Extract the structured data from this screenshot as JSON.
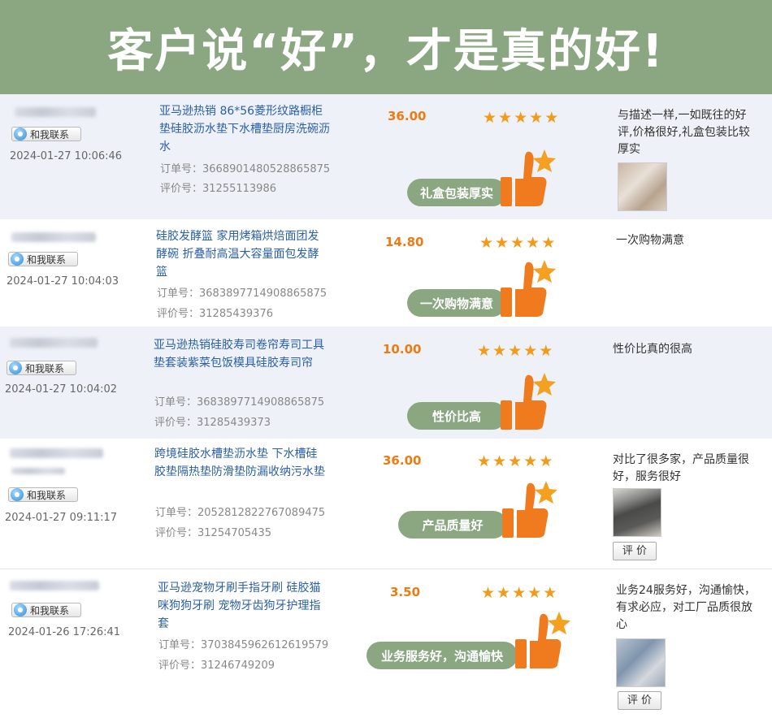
{
  "banner": {
    "title": "客户说“好”，才是真的好!"
  },
  "reviews": [
    {
      "contact_label": "和我联系",
      "date": "2024-01-27 10:06:46",
      "product_name": "亚马逊热销 86*56菱形纹路橱柜垫硅胶沥水垫下水槽垫厨房洗碗沥水",
      "order_no": "订单号：3668901480528865875",
      "review_no": "评价号：31255113986",
      "price": "36.00",
      "rating": 5,
      "tag": "礼盒包装厚实",
      "review_text": "与描述一样,一如既往的好评,价格很好,礼盒包装比较厚实",
      "has_photo": true
    },
    {
      "contact_label": "和我联系",
      "date": "2024-01-27 10:04:03",
      "product_name": "硅胶发酵篮 家用烤箱烘焙面团发酵碗 折叠耐高温大容量面包发酵篮",
      "order_no": "订单号：3683897714908865875",
      "review_no": "评价号：31285439376",
      "price": "14.80",
      "rating": 5,
      "tag": "一次购物满意",
      "review_text": "一次购物满意",
      "has_photo": false
    },
    {
      "contact_label": "和我联系",
      "date": "2024-01-27 10:04:02",
      "product_name": "亚马逊热销硅胶寿司卷帘寿司工具垫套装紫菜包饭模具硅胶寿司帘",
      "order_no": "订单号：3683897714908865875",
      "review_no": "评价号：31285439373",
      "price": "10.00",
      "rating": 5,
      "tag": "性价比高",
      "review_text": "性价比真的很高",
      "has_photo": false
    },
    {
      "contact_label": "和我联系",
      "date": "2024-01-27 09:11:17",
      "product_name": "跨境硅胶水槽垫沥水垫 下水槽硅胶垫隔热垫防滑垫防漏收纳污水垫",
      "order_no": "订单号：2052812822767089475",
      "review_no": "评价号：31254705435",
      "price": "36.00",
      "rating": 5,
      "tag": "产品质量好",
      "review_text": "对比了很多家，产品质量很好，服务很好",
      "has_photo": true,
      "rate_label": "评 价"
    },
    {
      "contact_label": "和我联系",
      "date": "2024-01-26 17:26:41",
      "product_name": "亚马逊宠物牙刷手指牙刷 硅胶猫咪狗狗牙刷 宠物牙齿狗牙护理指套",
      "order_no": "订单号：3703845962612619579",
      "review_no": "评价号：31246749209",
      "price": "3.50",
      "rating": 5,
      "tag": "业务服务好，沟通愉快",
      "review_text": "业务24服务好，沟通愉快，有求必应，对工厂品质很放心",
      "has_photo": true,
      "rate_label": "评 价"
    }
  ],
  "colors": {
    "banner": "#8aa781",
    "price": "#ef7a10",
    "star": "#f29a1a",
    "link": "#2a5fa8",
    "thumb": "#f07a1e"
  }
}
